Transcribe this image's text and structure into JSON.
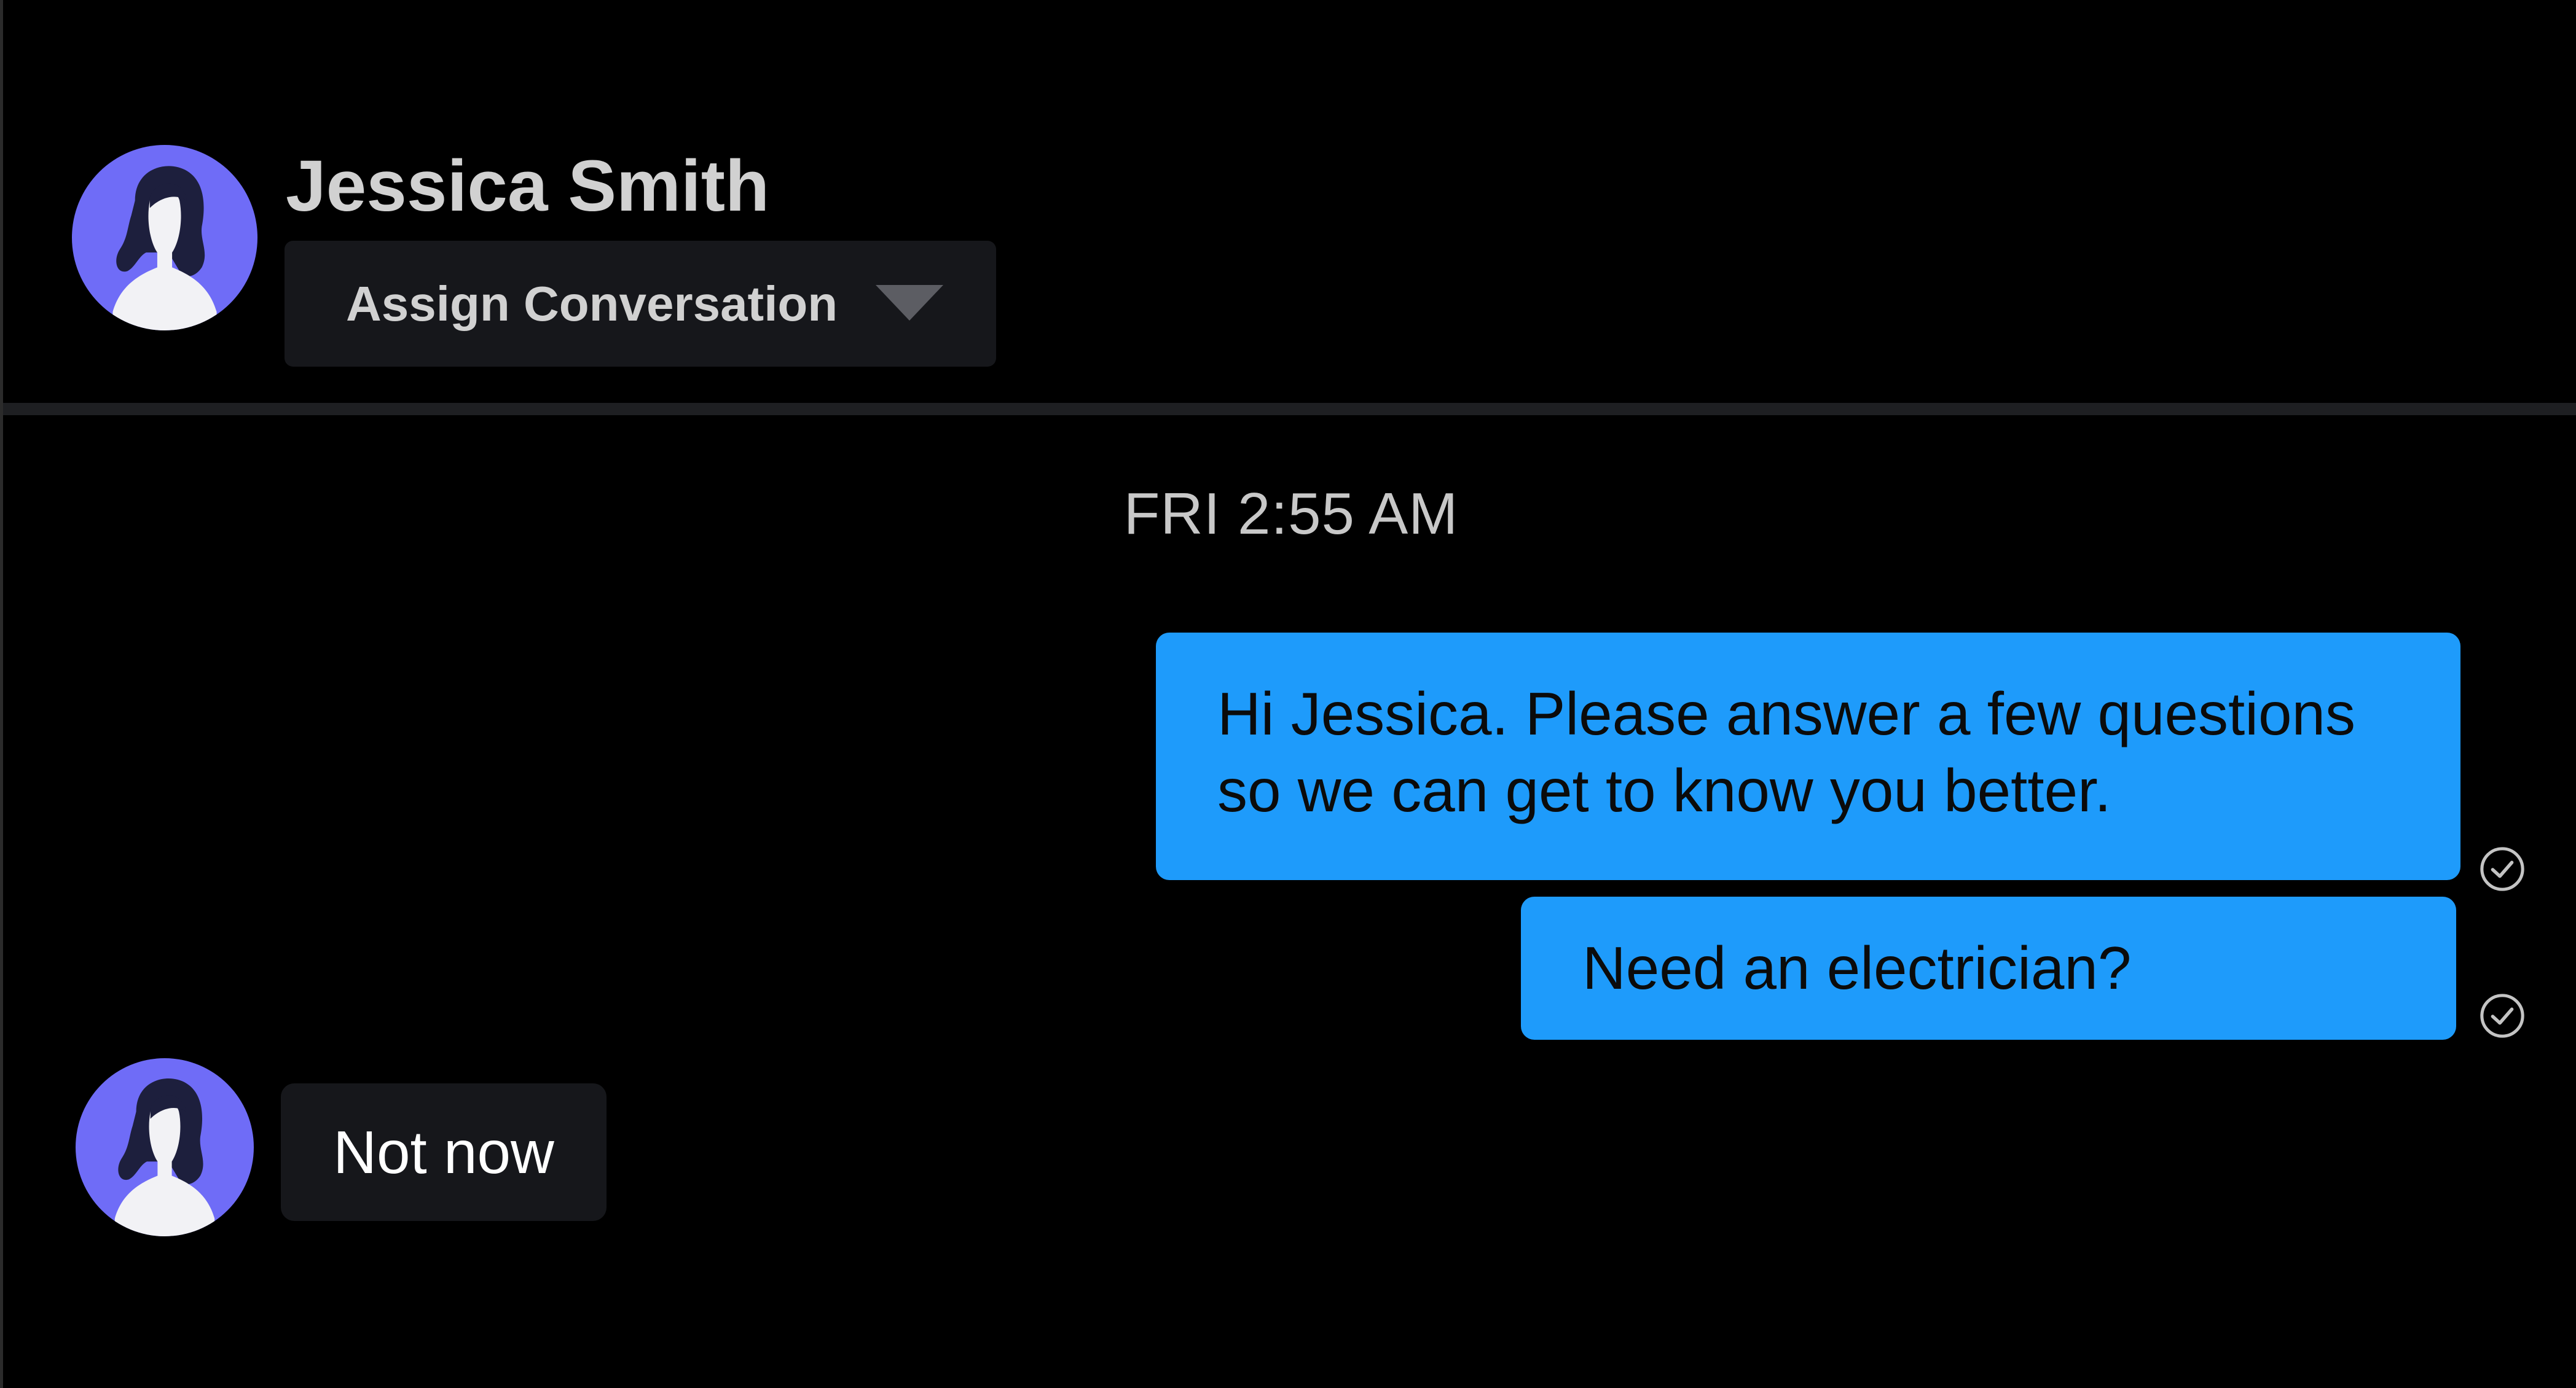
{
  "header": {
    "contact_name": "Jessica Smith",
    "assign_dropdown": {
      "label": "Assign Conversation",
      "icon": "chevron-down-icon"
    },
    "avatar_icon": "user-avatar-icon"
  },
  "conversation": {
    "timestamp": "FRI 2:55 AM",
    "messages": [
      {
        "direction": "outgoing",
        "text": "Hi Jessica. Please answer a few questions so we can get to know you better.",
        "status_icon": "read-check-icon"
      },
      {
        "direction": "outgoing",
        "text": "Need an electrician?",
        "status_icon": "read-check-icon"
      },
      {
        "direction": "incoming",
        "text": "Not now",
        "avatar_icon": "user-avatar-icon"
      }
    ]
  },
  "colors": {
    "background": "#000000",
    "outgoing_bubble": "#1e9bfb",
    "incoming_bubble": "#16171b",
    "avatar_circle": "#6f6cf7",
    "avatar_hair": "#1d1f3d",
    "header_text": "#d1d1d1",
    "divider": "#1e1f22"
  }
}
